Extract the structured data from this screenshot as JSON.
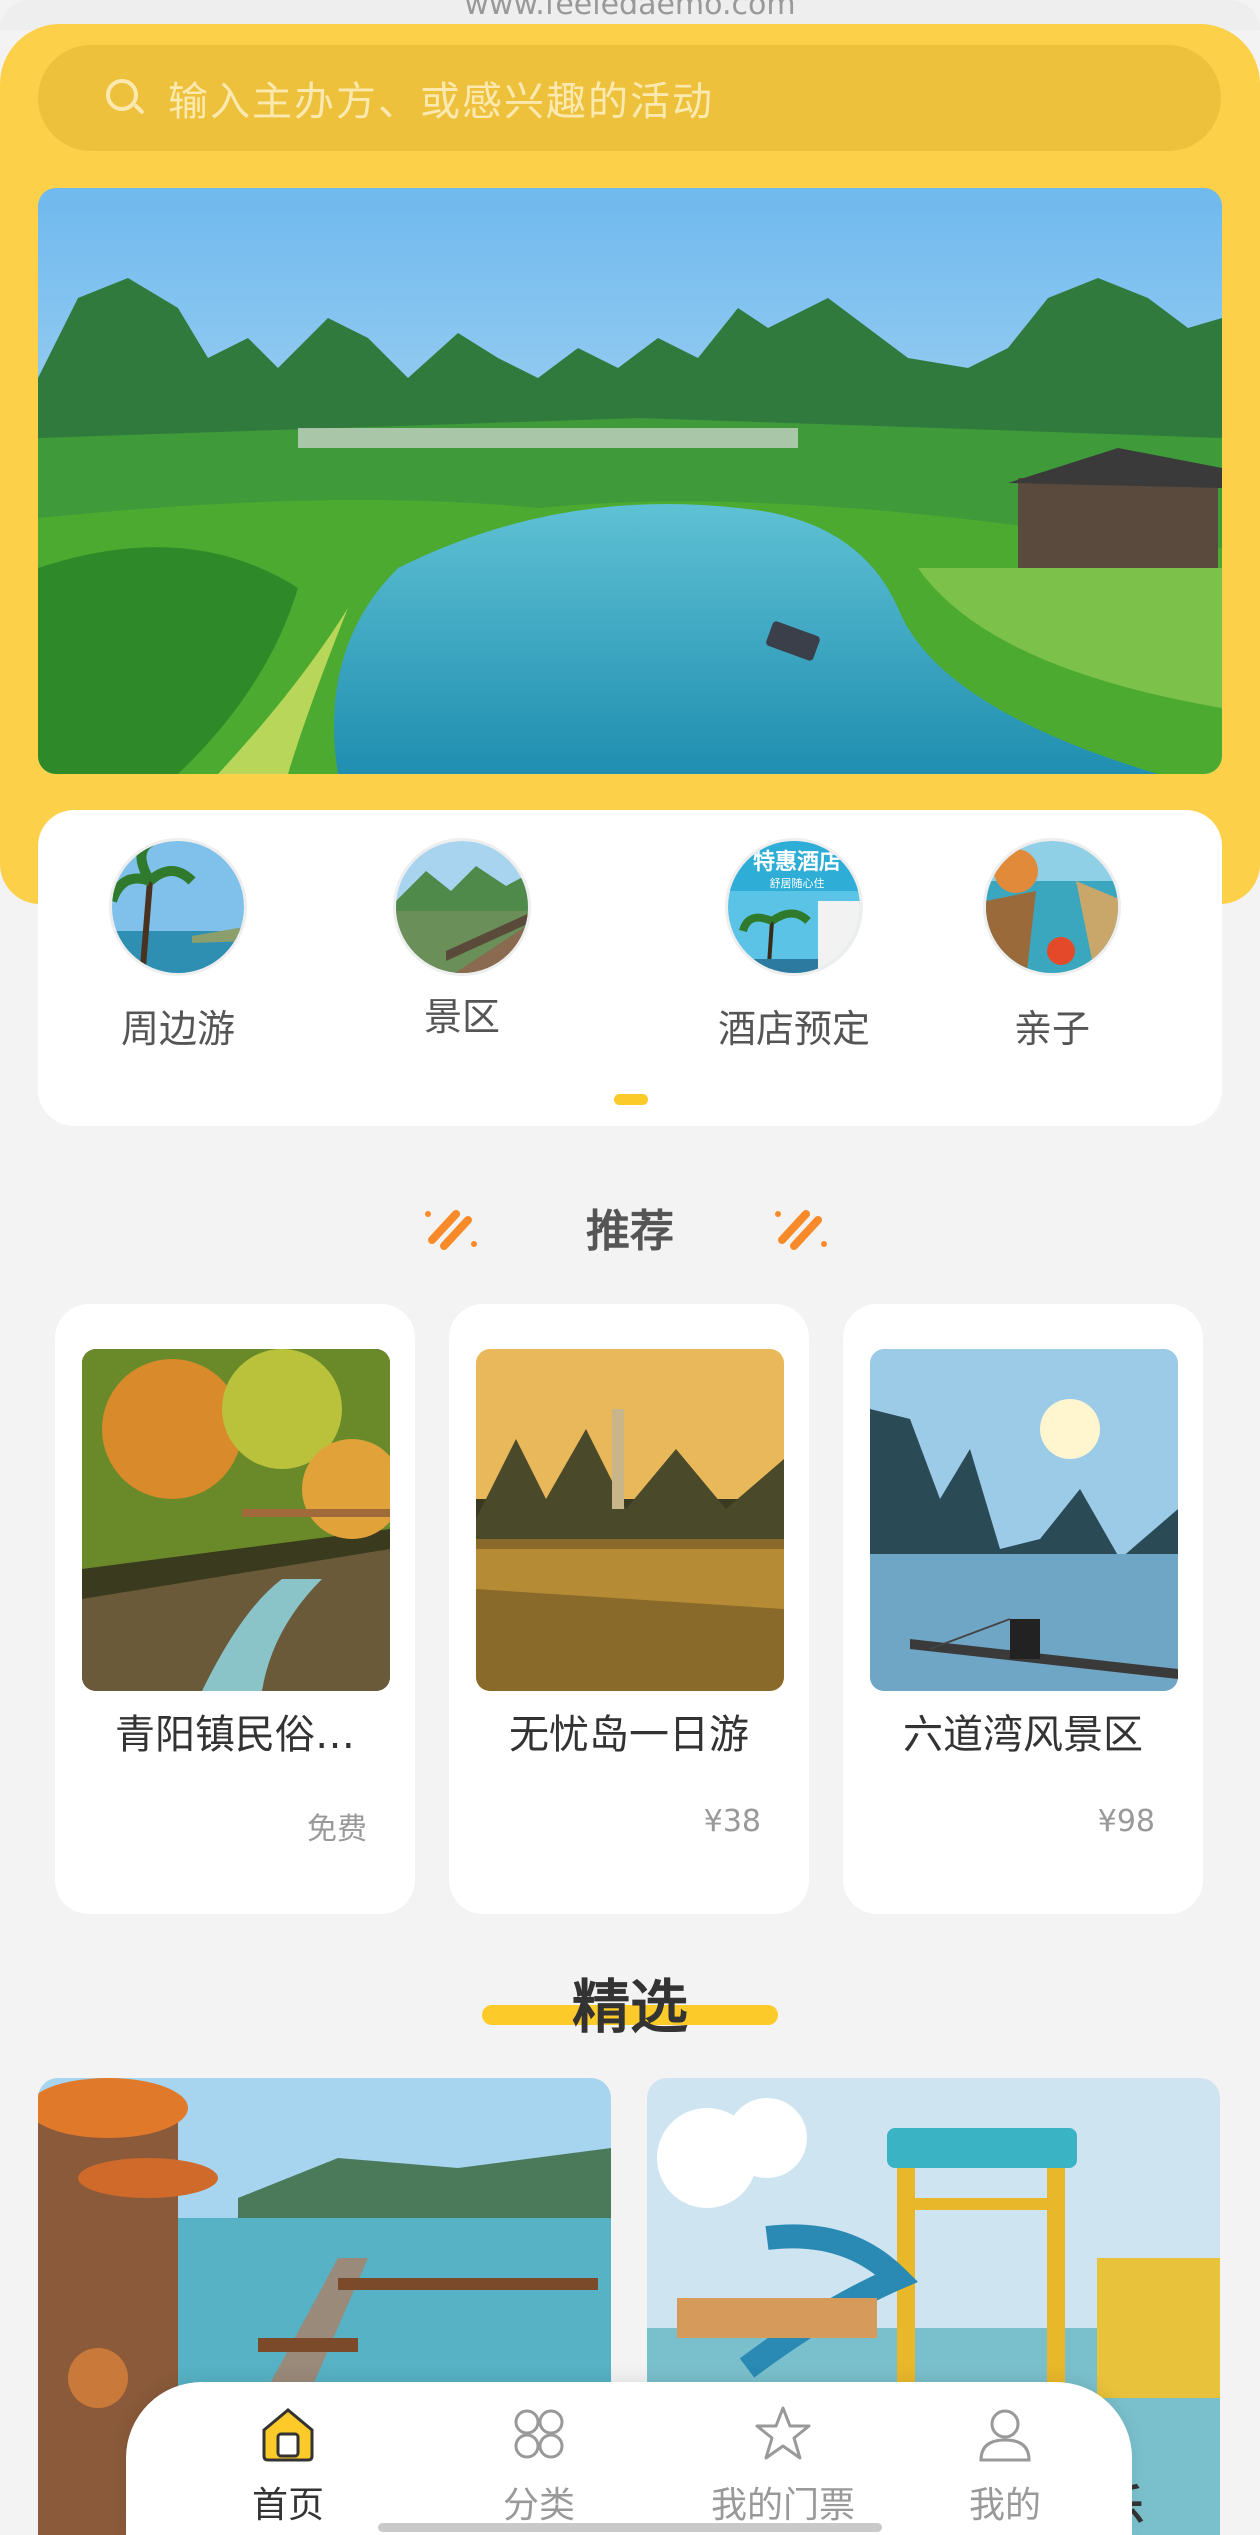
{
  "browser": {
    "url": "www.feeledaemo.com"
  },
  "search": {
    "placeholder": "输入主办方、或感兴趣的活动"
  },
  "categories": [
    {
      "label": "周边游",
      "icon": "palm-beach-image"
    },
    {
      "label": "景区",
      "icon": "scenic-area-image"
    },
    {
      "label": "酒店预定",
      "icon": "hotel-promo-image"
    },
    {
      "label": "亲子",
      "icon": "water-market-image"
    }
  ],
  "recommend": {
    "title": "推荐",
    "items": [
      {
        "name": "青阳镇民俗…",
        "price": "免费"
      },
      {
        "name": "无忧岛一日游",
        "price": "¥38"
      },
      {
        "name": "六道湾风景区",
        "price": "¥98"
      }
    ]
  },
  "featured": {
    "title": "精选",
    "peek_text": "乐"
  },
  "tabbar": {
    "items": [
      {
        "label": "首页",
        "icon": "home-icon",
        "active": true
      },
      {
        "label": "分类",
        "icon": "category-grid-icon",
        "active": false
      },
      {
        "label": "我的门票",
        "icon": "star-ticket-icon",
        "active": false
      },
      {
        "label": "我的",
        "icon": "user-icon",
        "active": false
      }
    ]
  },
  "colors": {
    "accent": "#fdd04a",
    "accent_dark": "#fccb2a",
    "orange": "#f98a2a"
  }
}
